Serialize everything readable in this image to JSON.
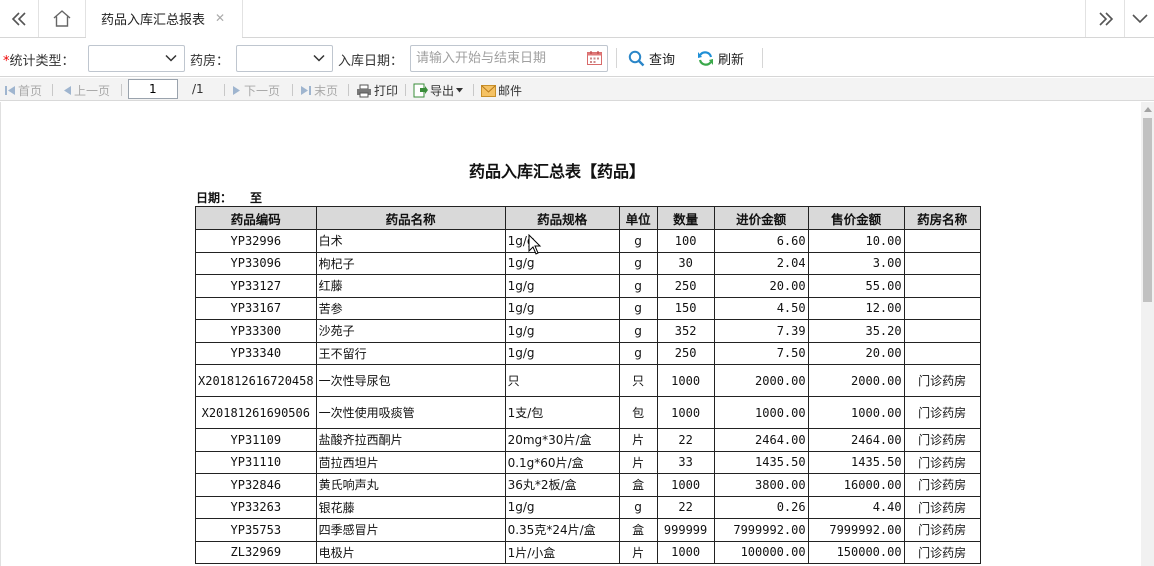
{
  "tabs": {
    "active_label": "药品入库汇总报表"
  },
  "filters": {
    "required_mark": "*",
    "type_label": "统计类型：",
    "pharmacy_label": "药房：",
    "date_label": "入库日期：",
    "date_placeholder": "请输入开始与结束日期",
    "query_label": "查询",
    "refresh_label": "刷新"
  },
  "report_toolbar": {
    "first": "首页",
    "prev": "上一页",
    "page_value": "1",
    "page_total": "/1",
    "next": "下一页",
    "last": "末页",
    "print": "打印",
    "export": "导出",
    "mail": "邮件"
  },
  "report": {
    "title": "药品入库汇总表【药品】",
    "date_label": "日期：",
    "date_to": "至",
    "columns": [
      "药品编码",
      "药品名称",
      "药品规格",
      "单位",
      "数量",
      "进价金额",
      "售价金额",
      "药房名称"
    ],
    "rows": [
      {
        "code": "YP32996",
        "name": "白术",
        "spec": "1g/g",
        "unit": "g",
        "qty": "100",
        "cost": "6.60",
        "price": "10.00",
        "pharmacy": ""
      },
      {
        "code": "YP33096",
        "name": "枸杞子",
        "spec": "1g/g",
        "unit": "g",
        "qty": "30",
        "cost": "2.04",
        "price": "3.00",
        "pharmacy": ""
      },
      {
        "code": "YP33127",
        "name": "红藤",
        "spec": "1g/g",
        "unit": "g",
        "qty": "250",
        "cost": "20.00",
        "price": "55.00",
        "pharmacy": ""
      },
      {
        "code": "YP33167",
        "name": "苦参",
        "spec": "1g/g",
        "unit": "g",
        "qty": "150",
        "cost": "4.50",
        "price": "12.00",
        "pharmacy": ""
      },
      {
        "code": "YP33300",
        "name": "沙苑子",
        "spec": "1g/g",
        "unit": "g",
        "qty": "352",
        "cost": "7.39",
        "price": "35.20",
        "pharmacy": ""
      },
      {
        "code": "YP33340",
        "name": "王不留行",
        "spec": "1g/g",
        "unit": "g",
        "qty": "250",
        "cost": "7.50",
        "price": "20.00",
        "pharmacy": ""
      },
      {
        "code": "X201812616720458",
        "name": "一次性导尿包",
        "spec": "只",
        "unit": "只",
        "qty": "1000",
        "cost": "2000.00",
        "price": "2000.00",
        "pharmacy": "门诊药房"
      },
      {
        "code": "X20181261690506",
        "name": "一次性使用吸痰管",
        "spec": "1支/包",
        "unit": "包",
        "qty": "1000",
        "cost": "1000.00",
        "price": "1000.00",
        "pharmacy": "门诊药房"
      },
      {
        "code": "YP31109",
        "name": "盐酸齐拉西酮片",
        "spec": "20mg*30片/盒",
        "unit": "片",
        "qty": "22",
        "cost": "2464.00",
        "price": "2464.00",
        "pharmacy": "门诊药房"
      },
      {
        "code": "YP31110",
        "name": "茴拉西坦片",
        "spec": "0.1g*60片/盒",
        "unit": "片",
        "qty": "33",
        "cost": "1435.50",
        "price": "1435.50",
        "pharmacy": "门诊药房"
      },
      {
        "code": "YP32846",
        "name": "黄氏响声丸",
        "spec": "36丸*2板/盒",
        "unit": "盒",
        "qty": "1000",
        "cost": "3800.00",
        "price": "16000.00",
        "pharmacy": "门诊药房"
      },
      {
        "code": "YP33263",
        "name": "银花藤",
        "spec": "1g/g",
        "unit": "g",
        "qty": "22",
        "cost": "0.26",
        "price": "4.40",
        "pharmacy": "门诊药房"
      },
      {
        "code": "YP35753",
        "name": "四季感冒片",
        "spec": "0.35克*24片/盒",
        "unit": "盒",
        "qty": "999999",
        "cost": "7999992.00",
        "price": "7999992.00",
        "pharmacy": "门诊药房"
      },
      {
        "code": "ZL32969",
        "name": "电极片",
        "spec": "1片/小盒",
        "unit": "片",
        "qty": "1000",
        "cost": "100000.00",
        "price": "150000.00",
        "pharmacy": "门诊药房"
      }
    ]
  }
}
